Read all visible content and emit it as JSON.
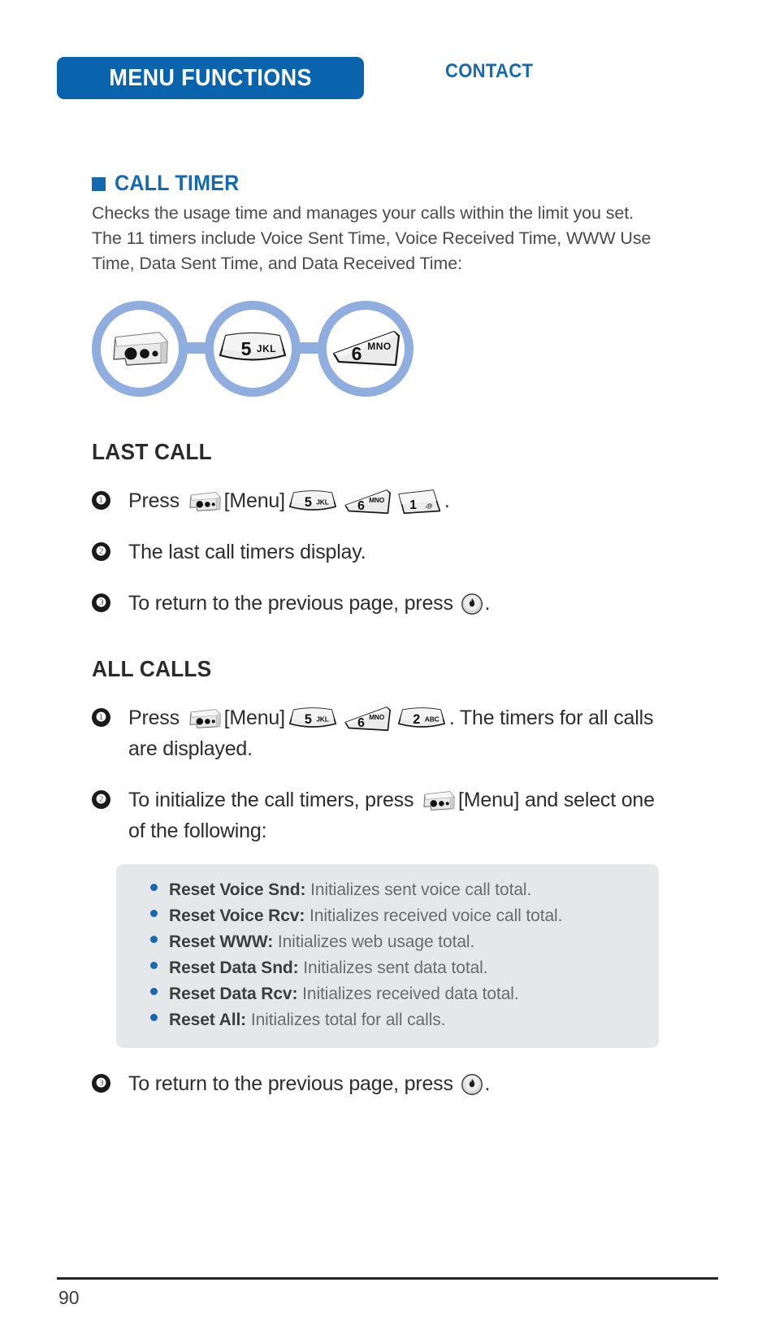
{
  "header": {
    "tab_label": "MENU FUNCTIONS",
    "section_label": "CONTACT",
    "tab_color": "#0a64ad",
    "section_color": "#1569b0"
  },
  "section": {
    "title": "CALL TIMER",
    "bullet_color": "#1569b0",
    "intro": "Checks the usage time and manages your calls within the limit you set. The 11 timers include Voice Sent Time, Voice Received Time, WWW Use Time, Data Sent Time, and Data Received Time:"
  },
  "diagram": {
    "ring_color": "#8fadde",
    "nodes": [
      {
        "icon": "menu-softkey-icon",
        "label": ""
      },
      {
        "icon": "key-5-icon",
        "digit": "5",
        "letters": "JKL"
      },
      {
        "icon": "key-6-icon",
        "digit": "6",
        "letters": "MNO"
      }
    ]
  },
  "last_call": {
    "heading": "LAST CALL",
    "steps": [
      {
        "number": "❶",
        "pre": "Press",
        "menu_label": "[Menu]",
        "keys": [
          {
            "digit": "5",
            "letters": "JKL"
          },
          {
            "digit": "6",
            "letters": "MNO"
          },
          {
            "digit": "1",
            "letters": ".@"
          }
        ],
        "post": "."
      },
      {
        "number": "❷",
        "text": "The last call timers display."
      },
      {
        "number": "❸",
        "pre": "To return to the previous page, press",
        "end_key": "end-key-icon",
        "post": "."
      }
    ]
  },
  "all_calls": {
    "heading": "ALL CALLS",
    "steps": [
      {
        "number": "❶",
        "pre": "Press",
        "menu_label": "[Menu]",
        "keys": [
          {
            "digit": "5",
            "letters": "JKL"
          },
          {
            "digit": "6",
            "letters": "MNO"
          },
          {
            "digit": "2",
            "letters": "ABC"
          }
        ],
        "post": ". The timers for all calls are displayed."
      },
      {
        "number": "❷",
        "pre": "To initialize the call timers, press",
        "menu_label": "[Menu] and select one of the following:"
      },
      {
        "number": "❸",
        "pre": "To return to the previous page, press",
        "end_key": "end-key-icon",
        "post": "."
      }
    ],
    "reset_panel": {
      "background": "#e6e7e9",
      "bullet_color": "#1569b0",
      "items": [
        {
          "label": "Reset Voice Snd:",
          "description": "Initializes sent voice call total."
        },
        {
          "label": "Reset Voice Rcv:",
          "description": "Initializes received voice call total."
        },
        {
          "label": "Reset WWW:",
          "description": "Initializes web usage total."
        },
        {
          "label": "Reset Data Snd:",
          "description": "Initializes sent data total."
        },
        {
          "label": "Reset Data Rcv:",
          "description": "Initializes received data total."
        },
        {
          "label": "Reset All:",
          "description": "Initializes total for all calls."
        }
      ]
    }
  },
  "footer": {
    "page_number": "90"
  }
}
